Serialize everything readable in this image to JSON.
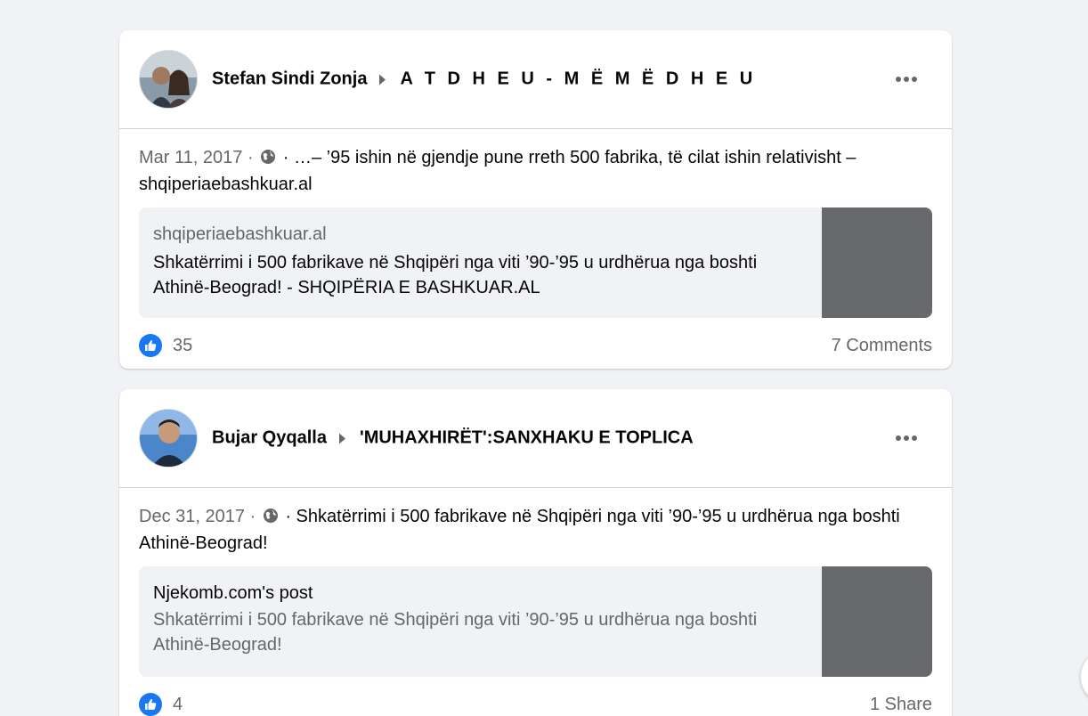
{
  "posts": [
    {
      "author": "Stefan Sindi Zonja",
      "group": "A T D H E U - M Ë M Ë D H E U",
      "date": "Mar 11, 2017",
      "separator": "·",
      "text_prefix": "· …– ’95 ishin në gjendje pune rreth 500 fabrika, të cilat ishin relativisht –",
      "text_line2": "shqiperiaebashkuar.al",
      "link": {
        "domain": "shqiperiaebashkuar.al",
        "title": "Shkatërrimi i 500 fabrikave në Shqipëri nga viti ’90-’95 u urdhërua nga boshti Athinë-Beograd! - SHQIPËRIA E BASHKUAR.AL"
      },
      "reactions": "35",
      "footer_right": "7 Comments"
    },
    {
      "author": "Bujar Qyqalla",
      "group": "'MUHAXHIRËT':SANXHAKU E TOPLICA",
      "date": "Dec 31, 2017",
      "separator": "·",
      "text_prefix": "· Shkatërrimi i 500 fabrikave në Shqipëri nga viti ’90-’95 u urdhërua nga boshti",
      "text_line2": "Athinë-Beograd!",
      "link": {
        "title": "Njekomb.com's post",
        "subtitle": "Shkatërrimi i 500 fabrikave në Shqipëri nga viti ’90-’95 u urdhërua nga boshti Athinë-Beograd!"
      },
      "reactions": "4",
      "footer_right": "1 Share"
    }
  ],
  "icons": {
    "like": "thumbs-up-icon",
    "globe": "globe-icon",
    "more": "more-options-icon"
  },
  "colors": {
    "accent": "#1877f2",
    "background": "#f0f2f5",
    "secondary_text": "#65676b"
  }
}
